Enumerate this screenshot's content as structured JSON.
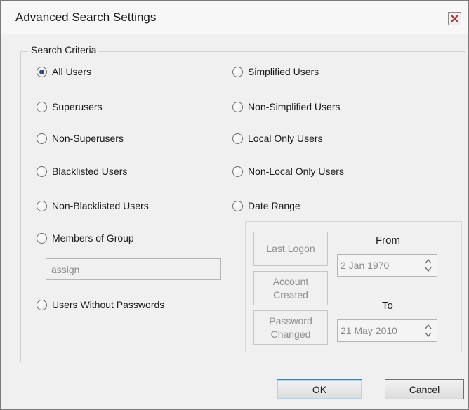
{
  "window": {
    "title": "Advanced Search Settings"
  },
  "group": {
    "label": "Search Criteria"
  },
  "left_options": [
    {
      "label": "All Users",
      "checked": true
    },
    {
      "label": "Superusers",
      "checked": false
    },
    {
      "label": "Non-Superusers",
      "checked": false
    },
    {
      "label": "Blacklisted Users",
      "checked": false
    },
    {
      "label": "Non-Blacklisted Users",
      "checked": false
    },
    {
      "label": "Members of Group",
      "checked": false
    },
    {
      "label": "Users Without Passwords",
      "checked": false
    }
  ],
  "right_options": [
    {
      "label": "Simplified Users",
      "checked": false
    },
    {
      "label": "Non-Simplified Users",
      "checked": false
    },
    {
      "label": "Local Only Users",
      "checked": false
    },
    {
      "label": "Non-Local Only Users",
      "checked": false
    },
    {
      "label": "Date Range",
      "checked": false
    }
  ],
  "group_input": {
    "value": "assign"
  },
  "date_panel": {
    "buttons": [
      {
        "line1": "Last Logon",
        "line2": ""
      },
      {
        "line1": "Account",
        "line2": "Created"
      },
      {
        "line1": "Password",
        "line2": "Changed"
      }
    ],
    "from_label": "From",
    "to_label": "To",
    "from_value": "2 Jan 1970",
    "to_value": "21 May 2010"
  },
  "buttons": {
    "ok": "OK",
    "cancel": "Cancel"
  },
  "colors": {
    "window_bg": "#f0f0f0",
    "radio_checked": "#2a4f86",
    "ok_border": "#3c7fb1",
    "disabled_text": "#8a8a8a"
  }
}
